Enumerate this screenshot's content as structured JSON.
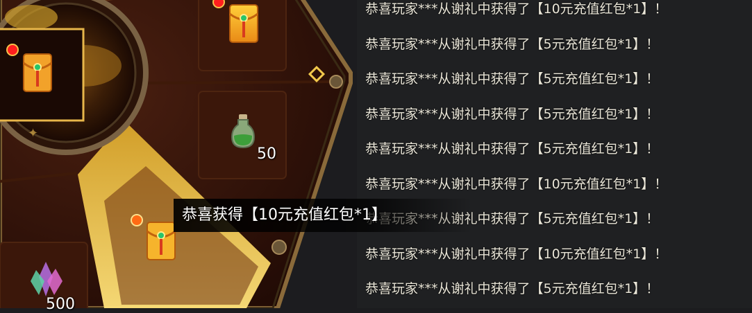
{
  "wheel": {
    "slots": [
      {
        "id": "top-item",
        "item": "red-envelope-icon",
        "badge": true
      },
      {
        "id": "center-item",
        "item": "red-envelope-icon",
        "badge": true
      },
      {
        "id": "potion-item",
        "item": "potion-icon",
        "quantity": "50"
      },
      {
        "id": "highlighted-item",
        "item": "red-envelope-icon",
        "badge": true
      },
      {
        "id": "crystal-item",
        "item": "crystal-icon",
        "quantity": "500"
      }
    ],
    "accent_color": "#f2c94c"
  },
  "toast": {
    "message": "恭喜获得【10元充值红包*1】"
  },
  "log": {
    "lines": [
      "恭喜玩家***从谢礼中获得了【10元充值红包*1】！",
      "恭喜玩家***从谢礼中获得了【5元充值红包*1】！",
      "恭喜玩家***从谢礼中获得了【5元充值红包*1】！",
      "恭喜玩家***从谢礼中获得了【5元充值红包*1】！",
      "恭喜玩家***从谢礼中获得了【5元充值红包*1】！",
      "恭喜玩家***从谢礼中获得了【10元充值红包*1】！",
      "恭喜玩家***从谢礼中获得了【5元充值红包*1】！",
      "恭喜玩家***从谢礼中获得了【10元充值红包*1】！",
      "恭喜玩家***从谢礼中获得了【5元充值红包*1】！"
    ]
  }
}
